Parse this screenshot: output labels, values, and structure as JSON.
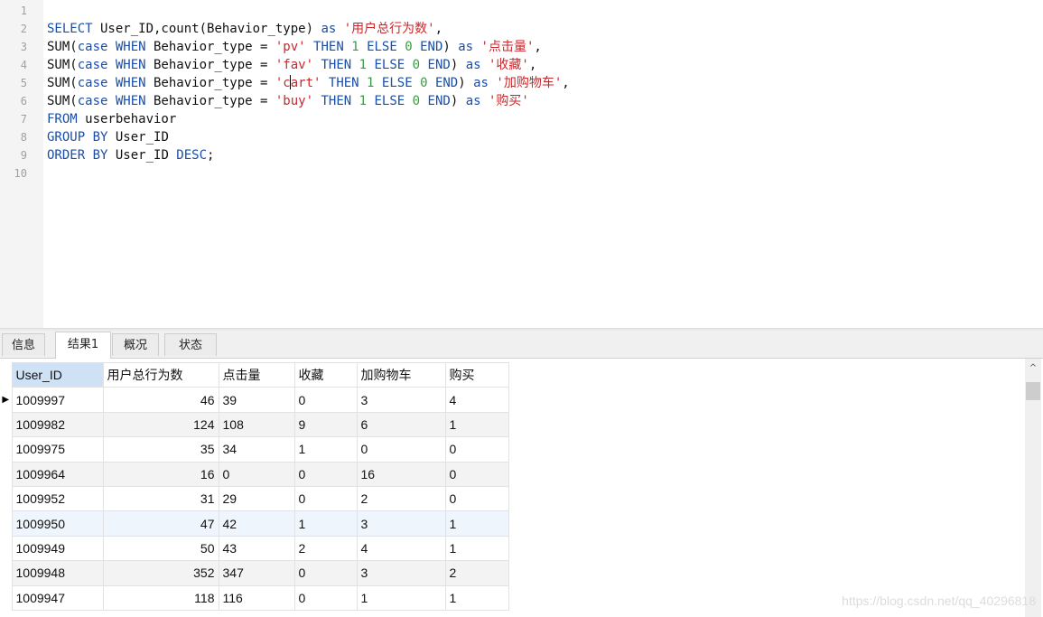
{
  "editor": {
    "lines": [
      {
        "n": "1",
        "tokens": []
      },
      {
        "n": "2",
        "tokens": [
          {
            "t": "kw",
            "v": "SELECT"
          },
          {
            "t": "id",
            "v": " User_ID,count(Behavior_type) "
          },
          {
            "t": "kw",
            "v": "as"
          },
          {
            "t": "op",
            "v": " "
          },
          {
            "t": "str",
            "v": "'用户总行为数'"
          },
          {
            "t": "op",
            "v": ","
          }
        ]
      },
      {
        "n": "3",
        "tokens": [
          {
            "t": "id",
            "v": "SUM("
          },
          {
            "t": "kw",
            "v": "case WHEN"
          },
          {
            "t": "id",
            "v": " Behavior_type = "
          },
          {
            "t": "str",
            "v": "'pv'"
          },
          {
            "t": "op",
            "v": " "
          },
          {
            "t": "kw",
            "v": "THEN"
          },
          {
            "t": "op",
            "v": " "
          },
          {
            "t": "num",
            "v": "1"
          },
          {
            "t": "op",
            "v": " "
          },
          {
            "t": "kw",
            "v": "ELSE"
          },
          {
            "t": "op",
            "v": " "
          },
          {
            "t": "num",
            "v": "0"
          },
          {
            "t": "op",
            "v": " "
          },
          {
            "t": "kw",
            "v": "END"
          },
          {
            "t": "id",
            "v": ") "
          },
          {
            "t": "kw",
            "v": "as"
          },
          {
            "t": "op",
            "v": " "
          },
          {
            "t": "str",
            "v": "'点击量'"
          },
          {
            "t": "op",
            "v": ","
          }
        ]
      },
      {
        "n": "4",
        "tokens": [
          {
            "t": "id",
            "v": "SUM("
          },
          {
            "t": "kw",
            "v": "case WHEN"
          },
          {
            "t": "id",
            "v": " Behavior_type = "
          },
          {
            "t": "str",
            "v": "'fav'"
          },
          {
            "t": "op",
            "v": " "
          },
          {
            "t": "kw",
            "v": "THEN"
          },
          {
            "t": "op",
            "v": " "
          },
          {
            "t": "num",
            "v": "1"
          },
          {
            "t": "op",
            "v": " "
          },
          {
            "t": "kw",
            "v": "ELSE"
          },
          {
            "t": "op",
            "v": " "
          },
          {
            "t": "num",
            "v": "0"
          },
          {
            "t": "op",
            "v": " "
          },
          {
            "t": "kw",
            "v": "END"
          },
          {
            "t": "id",
            "v": ") "
          },
          {
            "t": "kw",
            "v": "as"
          },
          {
            "t": "op",
            "v": " "
          },
          {
            "t": "str",
            "v": "'收藏'"
          },
          {
            "t": "op",
            "v": ","
          }
        ]
      },
      {
        "n": "5",
        "tokens": [
          {
            "t": "id",
            "v": "SUM("
          },
          {
            "t": "kw",
            "v": "case WHEN"
          },
          {
            "t": "id",
            "v": " Behavior_type = "
          },
          {
            "t": "str",
            "v": "'c"
          },
          {
            "t": "caret",
            "v": ""
          },
          {
            "t": "str",
            "v": "art'"
          },
          {
            "t": "op",
            "v": " "
          },
          {
            "t": "kw",
            "v": "THEN"
          },
          {
            "t": "op",
            "v": " "
          },
          {
            "t": "num",
            "v": "1"
          },
          {
            "t": "op",
            "v": " "
          },
          {
            "t": "kw",
            "v": "ELSE"
          },
          {
            "t": "op",
            "v": " "
          },
          {
            "t": "num",
            "v": "0"
          },
          {
            "t": "op",
            "v": " "
          },
          {
            "t": "kw",
            "v": "END"
          },
          {
            "t": "id",
            "v": ") "
          },
          {
            "t": "kw",
            "v": "as"
          },
          {
            "t": "op",
            "v": " "
          },
          {
            "t": "str",
            "v": "'加购物车'"
          },
          {
            "t": "op",
            "v": ","
          }
        ]
      },
      {
        "n": "6",
        "tokens": [
          {
            "t": "id",
            "v": "SUM("
          },
          {
            "t": "kw",
            "v": "case WHEN"
          },
          {
            "t": "id",
            "v": " Behavior_type = "
          },
          {
            "t": "str",
            "v": "'buy'"
          },
          {
            "t": "op",
            "v": " "
          },
          {
            "t": "kw",
            "v": "THEN"
          },
          {
            "t": "op",
            "v": " "
          },
          {
            "t": "num",
            "v": "1"
          },
          {
            "t": "op",
            "v": " "
          },
          {
            "t": "kw",
            "v": "ELSE"
          },
          {
            "t": "op",
            "v": " "
          },
          {
            "t": "num",
            "v": "0"
          },
          {
            "t": "op",
            "v": " "
          },
          {
            "t": "kw",
            "v": "END"
          },
          {
            "t": "id",
            "v": ") "
          },
          {
            "t": "kw",
            "v": "as"
          },
          {
            "t": "op",
            "v": " "
          },
          {
            "t": "str",
            "v": "'购买'"
          }
        ]
      },
      {
        "n": "7",
        "tokens": [
          {
            "t": "kw",
            "v": "FROM"
          },
          {
            "t": "id",
            "v": " userbehavior"
          }
        ]
      },
      {
        "n": "8",
        "tokens": [
          {
            "t": "kw",
            "v": "GROUP BY"
          },
          {
            "t": "id",
            "v": " User_ID"
          }
        ]
      },
      {
        "n": "9",
        "tokens": [
          {
            "t": "kw",
            "v": "ORDER BY"
          },
          {
            "t": "id",
            "v": " User_ID "
          },
          {
            "t": "kw",
            "v": "DESC"
          },
          {
            "t": "id",
            "v": ";"
          }
        ]
      },
      {
        "n": "10",
        "tokens": []
      }
    ]
  },
  "tabs": [
    {
      "label": "信息"
    },
    {
      "label": "结果1"
    },
    {
      "label": "概况"
    },
    {
      "label": "状态"
    }
  ],
  "active_tab": "结果1",
  "grid": {
    "columns": [
      "User_ID",
      "用户总行为数",
      "点击量",
      "收藏",
      "加购物车",
      "购买"
    ],
    "rows": [
      [
        "1009997",
        "46",
        "39",
        "0",
        "3",
        "4"
      ],
      [
        "1009982",
        "124",
        "108",
        "9",
        "6",
        "1"
      ],
      [
        "1009975",
        "35",
        "34",
        "1",
        "0",
        "0"
      ],
      [
        "1009964",
        "16",
        "0",
        "0",
        "16",
        "0"
      ],
      [
        "1009952",
        "31",
        "29",
        "0",
        "2",
        "0"
      ],
      [
        "1009950",
        "47",
        "42",
        "1",
        "3",
        "1"
      ],
      [
        "1009949",
        "50",
        "43",
        "2",
        "4",
        "1"
      ],
      [
        "1009948",
        "352",
        "347",
        "0",
        "3",
        "2"
      ],
      [
        "1009947",
        "118",
        "116",
        "0",
        "1",
        "1"
      ]
    ],
    "current_row_marker": "▶",
    "highlighted_row_index": 5
  },
  "scrollbar": {
    "up_arrow": "^"
  },
  "watermark": "https://blog.csdn.net/qq_40296818",
  "colors": {
    "keyword": "#1a4ea8",
    "string": "#c8282c",
    "number": "#3c9a44",
    "header_selected": "#cfe2f5"
  }
}
